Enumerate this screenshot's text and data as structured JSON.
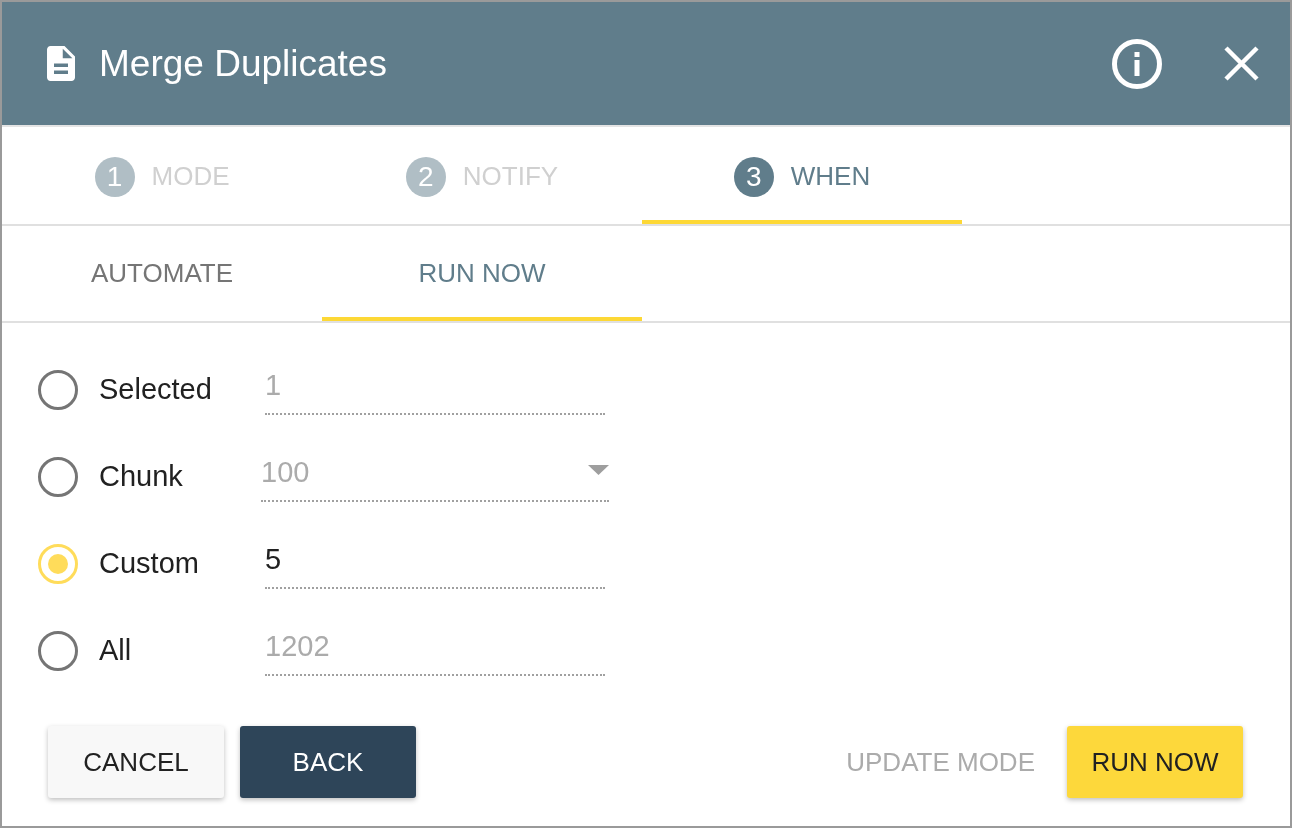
{
  "window": {
    "title": "Merge Duplicates"
  },
  "steps": [
    {
      "number": "1",
      "label": "MODE",
      "selected": false
    },
    {
      "number": "2",
      "label": "NOTIFY",
      "selected": false
    },
    {
      "number": "3",
      "label": "WHEN",
      "selected": true
    }
  ],
  "sub_tabs": [
    {
      "label": "AUTOMATE",
      "selected": false
    },
    {
      "label": "RUN NOW",
      "selected": true
    }
  ],
  "options": [
    {
      "label": "Selected",
      "kind": "text",
      "value": "1",
      "selected": false
    },
    {
      "label": "Chunk",
      "kind": "dropdown",
      "value": "100",
      "selected": false
    },
    {
      "label": "Custom",
      "kind": "text",
      "value": "5",
      "selected": true
    },
    {
      "label": "All",
      "kind": "text",
      "value": "1202",
      "selected": false
    }
  ],
  "footer": {
    "left_buttons": [
      {
        "label": "CANCEL",
        "kind": "raised",
        "disabled": false
      },
      {
        "label": "BACK",
        "kind": "dark",
        "disabled": false
      }
    ],
    "right_buttons": [
      {
        "label": "UPDATE MODE",
        "kind": "flat",
        "disabled": true
      },
      {
        "label": "RUN NOW",
        "kind": "accent",
        "disabled": false
      }
    ]
  }
}
